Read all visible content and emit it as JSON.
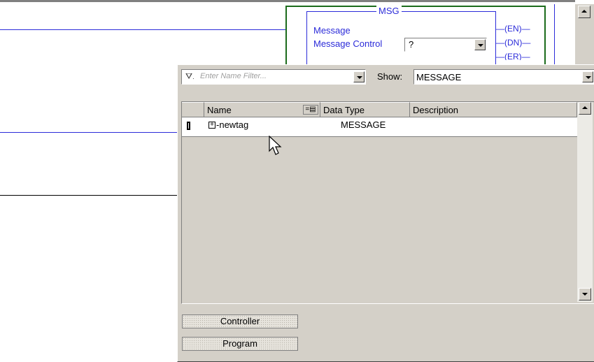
{
  "ladder": {
    "instruction_title": "MSG",
    "operand_message_label": "Message",
    "operand_control_label": "Message Control",
    "operand_control_value": "?",
    "outputs": [
      "EN",
      "DN",
      "ER"
    ]
  },
  "tag_browser": {
    "filter_placeholder": "Enter Name Filter...",
    "show_label": "Show:",
    "show_value": "MESSAGE",
    "columns": [
      "Name",
      "Data Type",
      "Description"
    ],
    "rows": [
      {
        "name": "newtag",
        "data_type": "MESSAGE",
        "description": ""
      }
    ],
    "scope_buttons": [
      "Controller",
      "Program"
    ]
  }
}
